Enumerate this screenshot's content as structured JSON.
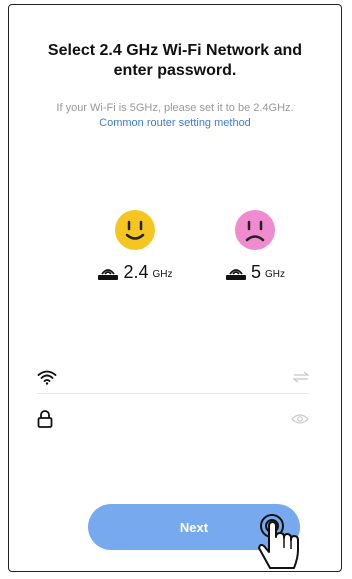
{
  "header": {
    "title_line1": "Select 2.4 GHz Wi-Fi Network and",
    "title_line2": "enter password.",
    "subtitle": "If your Wi-Fi is 5GHz, please set it to be 2.4GHz.",
    "help_link": "Common router setting method"
  },
  "bands": [
    {
      "number": "2.4",
      "unit": "GHz",
      "face": "smiley-face-icon",
      "face_color": "#f5c521"
    },
    {
      "number": "5",
      "unit": "GHz",
      "face": "sad-face-icon",
      "face_color": "#f08bd0"
    }
  ],
  "wifi_field": {
    "value": "",
    "placeholder": "",
    "icon": "wifi-icon",
    "action_icon": "switch-network-icon"
  },
  "password_field": {
    "value": "",
    "placeholder": "",
    "icon": "lock-icon",
    "action_icon": "eye-icon"
  },
  "next_button": {
    "label": "Next",
    "color": "#76a9ee"
  }
}
